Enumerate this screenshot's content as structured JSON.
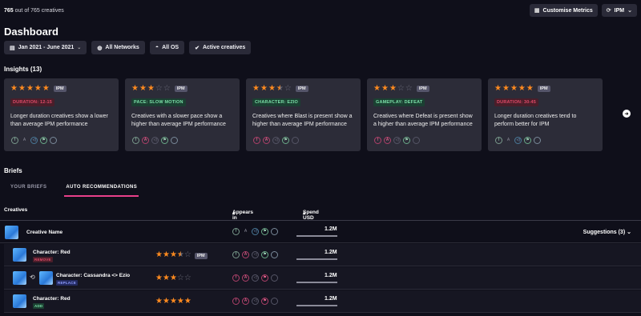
{
  "header": {
    "count_shown": "765",
    "count_rest": "out of 765 creatives",
    "customise_label": "Customise Metrics",
    "metric_label": "IPM"
  },
  "title": "Dashboard",
  "filters": [
    "Jan 2021 - June 2021",
    "All Networks",
    "All OS",
    "Active creatives"
  ],
  "insights": {
    "heading": "Insights (13)",
    "cards": [
      {
        "rating": 5,
        "tag": "DURATION: 12-15",
        "tag_color": "red",
        "desc": "Longer duration creatives show a lower than average IPM performance"
      },
      {
        "rating": 3,
        "tag": "PACE: SLOW MOTION",
        "tag_color": "green",
        "desc": "Creatives with a slower pace show a higher than average IPM performance"
      },
      {
        "rating": 3.5,
        "tag": "CHARACTER: EZIO",
        "tag_color": "green",
        "desc": "Creatives where Blast is present show a higher than average IPM performance"
      },
      {
        "rating": 3,
        "tag": "GAMEPLAY: DEFEAT",
        "tag_color": "green",
        "desc": "Creatives where Defeat is present show a higher than average IPM performance"
      },
      {
        "rating": 5,
        "tag": "DURATION: 30-45",
        "tag_color": "red",
        "desc": "Longer duration creatives tend to perform better for IPM"
      }
    ],
    "ipm_badge": "IPM"
  },
  "briefs": {
    "heading": "Briefs",
    "tabs": [
      "YOUR BRIEFS",
      "AUTO RECOMMENDATIONS"
    ]
  },
  "table": {
    "headers": {
      "creatives": "Creatives",
      "appears_in": "Appears in",
      "spend": "Spend USD"
    },
    "main_row": {
      "name": "Creative Name",
      "spend": "1.2M",
      "suggestions": "Suggestions (3)"
    },
    "sub_rows": [
      {
        "name": "Character: Red",
        "badge": "REMOVE",
        "rating": 3.5,
        "ipm": "IPM",
        "spend": "1.2M"
      },
      {
        "name": "Character: Cassandra <> Ezio",
        "badge": "REPLACE",
        "rating": 3,
        "spend": "1.2M"
      },
      {
        "name": "Character: Red",
        "badge": "ADD",
        "rating": 5,
        "spend": "1.2M"
      }
    ]
  },
  "colors": {
    "accent": "#e8408a",
    "star": "#ff8a1f",
    "background": "#0f0f1a"
  }
}
